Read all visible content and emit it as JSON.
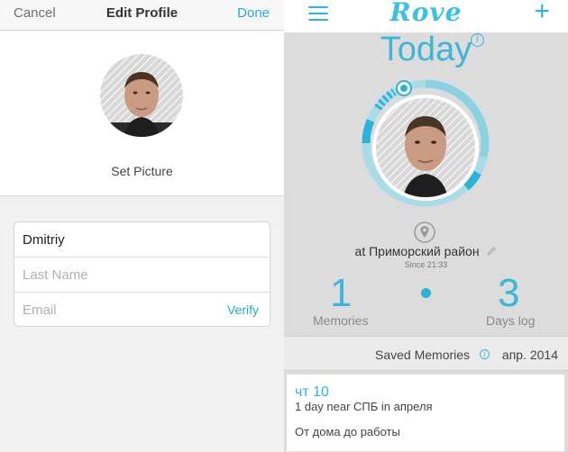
{
  "colors": {
    "accent": "#2db3d6",
    "today": "#3cb7d8",
    "ring_light": "#a9dce9"
  },
  "edit_profile": {
    "nav": {
      "cancel_label": "Cancel",
      "title": "Edit Profile",
      "done_label": "Done"
    },
    "set_picture_label": "Set Picture",
    "form": {
      "first_name_value": "Dmitriy",
      "last_name_placeholder": "Last Name",
      "email_placeholder": "Email",
      "verify_label": "Verify"
    }
  },
  "rove": {
    "nav": {
      "logo": "Rove",
      "menu_icon": "hamburger-menu-icon",
      "add_icon": "plus-icon"
    },
    "today_label": "Today",
    "location": {
      "text": "at Приморский район",
      "since": "Since 21:33"
    },
    "stats": {
      "memories_count": "1",
      "memories_label": "Memories",
      "days_count": "3",
      "days_label": "Days log"
    },
    "saved": {
      "label": "Saved Memories",
      "date": "апр. 2014"
    },
    "memory_card": {
      "day": "чт 10",
      "summary": "1 day near СПБ in апреля",
      "route": "От дома до работы"
    }
  }
}
